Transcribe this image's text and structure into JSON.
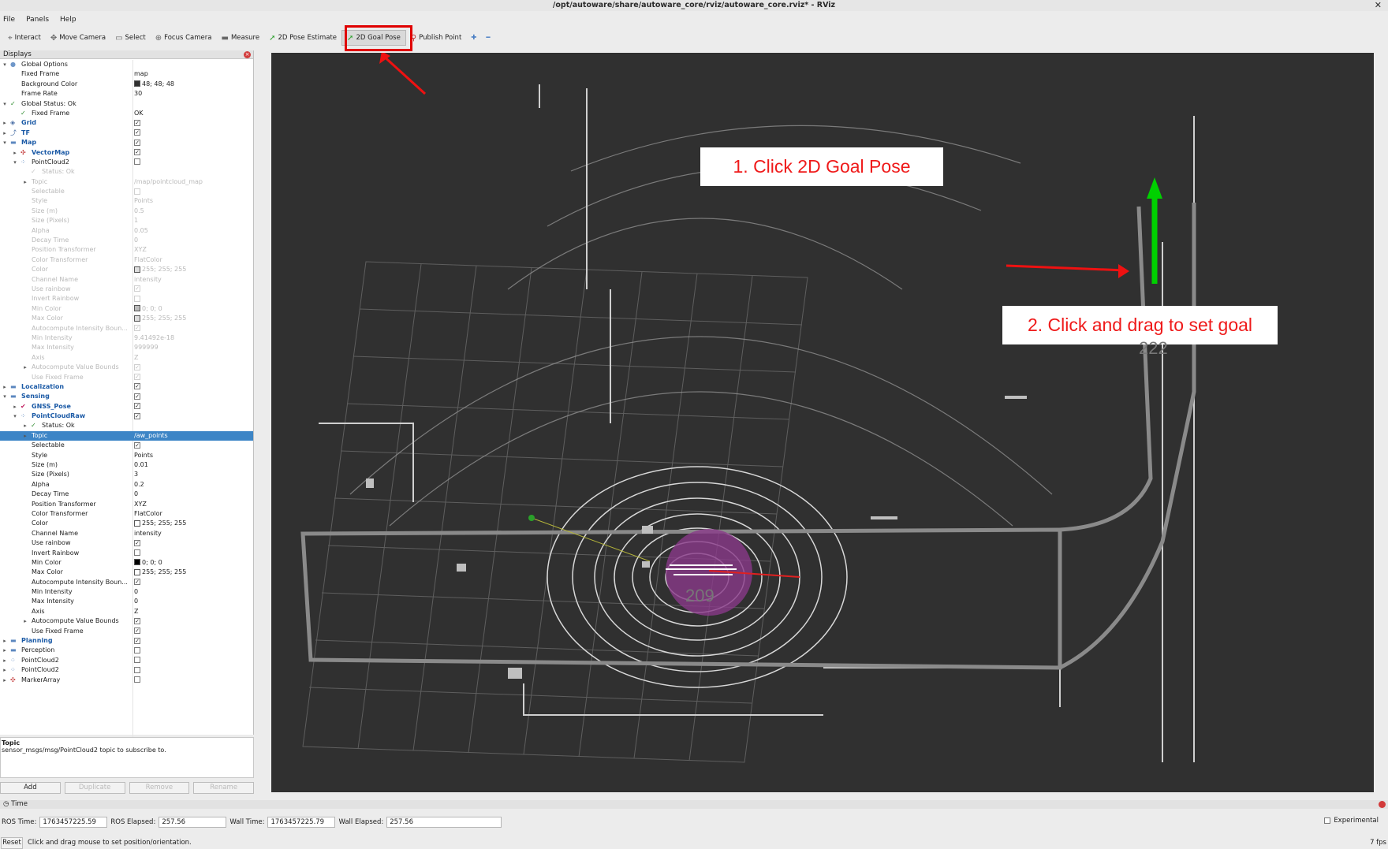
{
  "window": {
    "title": "/opt/autoware/share/autoware_core/rviz/autoware_core.rviz* - RViz"
  },
  "menu": [
    "File",
    "Panels",
    "Help"
  ],
  "toolbar": {
    "tools": [
      {
        "label": "Interact",
        "icon": "cursor-icon"
      },
      {
        "label": "Move Camera",
        "icon": "move-icon"
      },
      {
        "label": "Select",
        "icon": "select-icon"
      },
      {
        "label": "Focus Camera",
        "icon": "focus-icon"
      },
      {
        "label": "Measure",
        "icon": "ruler-icon"
      },
      {
        "label": "2D Pose Estimate",
        "icon": "pose-arrow-icon"
      },
      {
        "label": "2D Goal Pose",
        "icon": "goal-arrow-icon",
        "active": true
      },
      {
        "label": "Publish Point",
        "icon": "pin-icon"
      }
    ]
  },
  "displays": {
    "title": "Displays",
    "rows": [
      {
        "indent": 0,
        "exp": "▾",
        "icon": "●",
        "iconColor": "#6f97c9",
        "label": "Global Options",
        "value": ""
      },
      {
        "indent": 1,
        "label": "Fixed Frame",
        "value": "map"
      },
      {
        "indent": 1,
        "label": "Background Color",
        "value": "48; 48; 48",
        "swatch": "#303030"
      },
      {
        "indent": 1,
        "label": "Frame Rate",
        "value": "30"
      },
      {
        "indent": 0,
        "exp": "▾",
        "icon": "✓",
        "iconColor": "#2e8b2e",
        "label": "Global Status: Ok",
        "value": ""
      },
      {
        "indent": 1,
        "icon": "✓",
        "iconColor": "#2e8b2e",
        "label": "Fixed Frame",
        "value": "OK"
      },
      {
        "indent": 0,
        "exp": "▸",
        "icon": "◈",
        "iconColor": "#4a6fa5",
        "label": "Grid",
        "check": true,
        "bold": true
      },
      {
        "indent": 0,
        "exp": "▸",
        "icon": "⤴",
        "iconColor": "#4a6fa5",
        "label": "TF",
        "check": true,
        "bold": true
      },
      {
        "indent": 0,
        "exp": "▾",
        "icon": "▬",
        "iconColor": "#5b87bf",
        "label": "Map",
        "check": true,
        "bold": true
      },
      {
        "indent": 1,
        "exp": "▸",
        "icon": "✣",
        "iconColor": "#c03030",
        "label": "VectorMap",
        "check": true,
        "bold": true
      },
      {
        "indent": 1,
        "exp": "▾",
        "icon": "⁘",
        "iconColor": "#5b87bf",
        "label": "PointCloud2",
        "check": false
      },
      {
        "indent": 2,
        "icon": "✓",
        "iconColor": "#aaa",
        "label": "Status: Ok",
        "disabled": true
      },
      {
        "indent": 2,
        "exp": "▸",
        "label": "Topic",
        "value": "/map/pointcloud_map",
        "disabled": true
      },
      {
        "indent": 2,
        "label": "Selectable",
        "check": false,
        "disabled": true
      },
      {
        "indent": 2,
        "label": "Style",
        "value": "Points",
        "disabled": true
      },
      {
        "indent": 2,
        "label": "Size (m)",
        "value": "0.5",
        "disabled": true
      },
      {
        "indent": 2,
        "label": "Size (Pixels)",
        "value": "1",
        "disabled": true
      },
      {
        "indent": 2,
        "label": "Alpha",
        "value": "0.05",
        "disabled": true
      },
      {
        "indent": 2,
        "label": "Decay Time",
        "value": "0",
        "disabled": true
      },
      {
        "indent": 2,
        "label": "Position Transformer",
        "value": "XYZ",
        "disabled": true
      },
      {
        "indent": 2,
        "label": "Color Transformer",
        "value": "FlatColor",
        "disabled": true
      },
      {
        "indent": 2,
        "label": "Color",
        "value": "255; 255; 255",
        "swatch": "#dddddd",
        "disabled": true
      },
      {
        "indent": 2,
        "label": "Channel Name",
        "value": "intensity",
        "disabled": true
      },
      {
        "indent": 2,
        "label": "Use rainbow",
        "check": true,
        "disabled": true
      },
      {
        "indent": 2,
        "label": "Invert Rainbow",
        "check": false,
        "disabled": true
      },
      {
        "indent": 2,
        "label": "Min Color",
        "value": "0; 0; 0",
        "swatch": "#bbbbbb",
        "disabled": true
      },
      {
        "indent": 2,
        "label": "Max Color",
        "value": "255; 255; 255",
        "swatch": "#dddddd",
        "disabled": true
      },
      {
        "indent": 2,
        "label": "Autocompute Intensity Boun...",
        "check": true,
        "disabled": true
      },
      {
        "indent": 2,
        "label": "Min Intensity",
        "value": "9.41492e-18",
        "disabled": true
      },
      {
        "indent": 2,
        "label": "Max Intensity",
        "value": "999999",
        "disabled": true
      },
      {
        "indent": 2,
        "label": "Axis",
        "value": "Z",
        "disabled": true
      },
      {
        "indent": 2,
        "exp": "▸",
        "label": "Autocompute Value Bounds",
        "check": true,
        "disabled": true
      },
      {
        "indent": 2,
        "label": "Use Fixed Frame",
        "check": true,
        "disabled": true
      },
      {
        "indent": 0,
        "exp": "▸",
        "icon": "▬",
        "iconColor": "#5b87bf",
        "label": "Localization",
        "check": true,
        "bold": true
      },
      {
        "indent": 0,
        "exp": "▾",
        "icon": "▬",
        "iconColor": "#5b87bf",
        "label": "Sensing",
        "check": true,
        "bold": true
      },
      {
        "indent": 1,
        "exp": "▸",
        "icon": "✔",
        "iconColor": "#c02060",
        "label": "GNSS_Pose",
        "check": true,
        "bold": true
      },
      {
        "indent": 1,
        "exp": "▾",
        "icon": "⁘",
        "iconColor": "#5b87bf",
        "label": "PointCloudRaw",
        "check": true,
        "bold": true
      },
      {
        "indent": 2,
        "exp": "▸",
        "icon": "✓",
        "iconColor": "#2e8b2e",
        "label": "Status: Ok"
      },
      {
        "indent": 2,
        "exp": "▸",
        "label": "Topic",
        "value": "/aw_points",
        "selected": true
      },
      {
        "indent": 2,
        "label": "Selectable",
        "check": true
      },
      {
        "indent": 2,
        "label": "Style",
        "value": "Points"
      },
      {
        "indent": 2,
        "label": "Size (m)",
        "value": "0.01"
      },
      {
        "indent": 2,
        "label": "Size (Pixels)",
        "value": "3"
      },
      {
        "indent": 2,
        "label": "Alpha",
        "value": "0.2"
      },
      {
        "indent": 2,
        "label": "Decay Time",
        "value": "0"
      },
      {
        "indent": 2,
        "label": "Position Transformer",
        "value": "XYZ"
      },
      {
        "indent": 2,
        "label": "Color Transformer",
        "value": "FlatColor"
      },
      {
        "indent": 2,
        "label": "Color",
        "value": "255; 255; 255",
        "swatch": "#ffffff"
      },
      {
        "indent": 2,
        "label": "Channel Name",
        "value": "intensity"
      },
      {
        "indent": 2,
        "label": "Use rainbow",
        "check": true
      },
      {
        "indent": 2,
        "label": "Invert Rainbow",
        "check": false
      },
      {
        "indent": 2,
        "label": "Min Color",
        "value": "0; 0; 0",
        "swatch": "#000000"
      },
      {
        "indent": 2,
        "label": "Max Color",
        "value": "255; 255; 255",
        "swatch": "#ffffff"
      },
      {
        "indent": 2,
        "label": "Autocompute Intensity Boun...",
        "check": true
      },
      {
        "indent": 2,
        "label": "Min Intensity",
        "value": "0"
      },
      {
        "indent": 2,
        "label": "Max Intensity",
        "value": "0"
      },
      {
        "indent": 2,
        "label": "Axis",
        "value": "Z"
      },
      {
        "indent": 2,
        "exp": "▸",
        "label": "Autocompute Value Bounds",
        "check": true
      },
      {
        "indent": 2,
        "label": "Use Fixed Frame",
        "check": true
      },
      {
        "indent": 0,
        "exp": "▸",
        "icon": "▬",
        "iconColor": "#5b87bf",
        "label": "Planning",
        "check": true,
        "bold": true
      },
      {
        "indent": 0,
        "exp": "▸",
        "icon": "▬",
        "iconColor": "#5b87bf",
        "label": "Perception",
        "check": false
      },
      {
        "indent": 0,
        "exp": "▸",
        "icon": "⁘",
        "iconColor": "#5b87bf",
        "label": "PointCloud2",
        "check": false
      },
      {
        "indent": 0,
        "exp": "▸",
        "icon": "⁘",
        "iconColor": "#5b87bf",
        "label": "PointCloud2",
        "check": false
      },
      {
        "indent": 0,
        "exp": "▸",
        "icon": "✣",
        "iconColor": "#c03030",
        "label": "MarkerArray",
        "check": false
      }
    ]
  },
  "description": {
    "title": "Topic",
    "text": "sensor_msgs/msg/PointCloud2 topic to subscribe to."
  },
  "panel_buttons": [
    {
      "label": "Add",
      "enabled": true
    },
    {
      "label": "Duplicate",
      "enabled": false
    },
    {
      "label": "Remove",
      "enabled": false
    },
    {
      "label": "Rename",
      "enabled": false
    }
  ],
  "annotations": {
    "step1": "1. Click 2D Goal Pose",
    "step2": "2. Click and drag to set goal"
  },
  "map_labels": {
    "upper": "222",
    "lower": "209"
  },
  "time_panel": {
    "title": "Time",
    "ros_time_label": "ROS Time:",
    "ros_time": "1763457225.59",
    "ros_elapsed_label": "ROS Elapsed:",
    "ros_elapsed": "257.56",
    "wall_time_label": "Wall Time:",
    "wall_time": "1763457225.79",
    "wall_elapsed_label": "Wall Elapsed:",
    "wall_elapsed": "257.56",
    "experimental_label": "Experimental"
  },
  "status": {
    "reset_label": "Reset",
    "message": "Click and drag mouse to set position/orientation.",
    "fps": "7 fps"
  },
  "colors": {
    "viewport_bg": "#303030",
    "annotation_red": "#ef1a1a",
    "goal_green": "#00d000",
    "highlight": "#3d85c6"
  }
}
